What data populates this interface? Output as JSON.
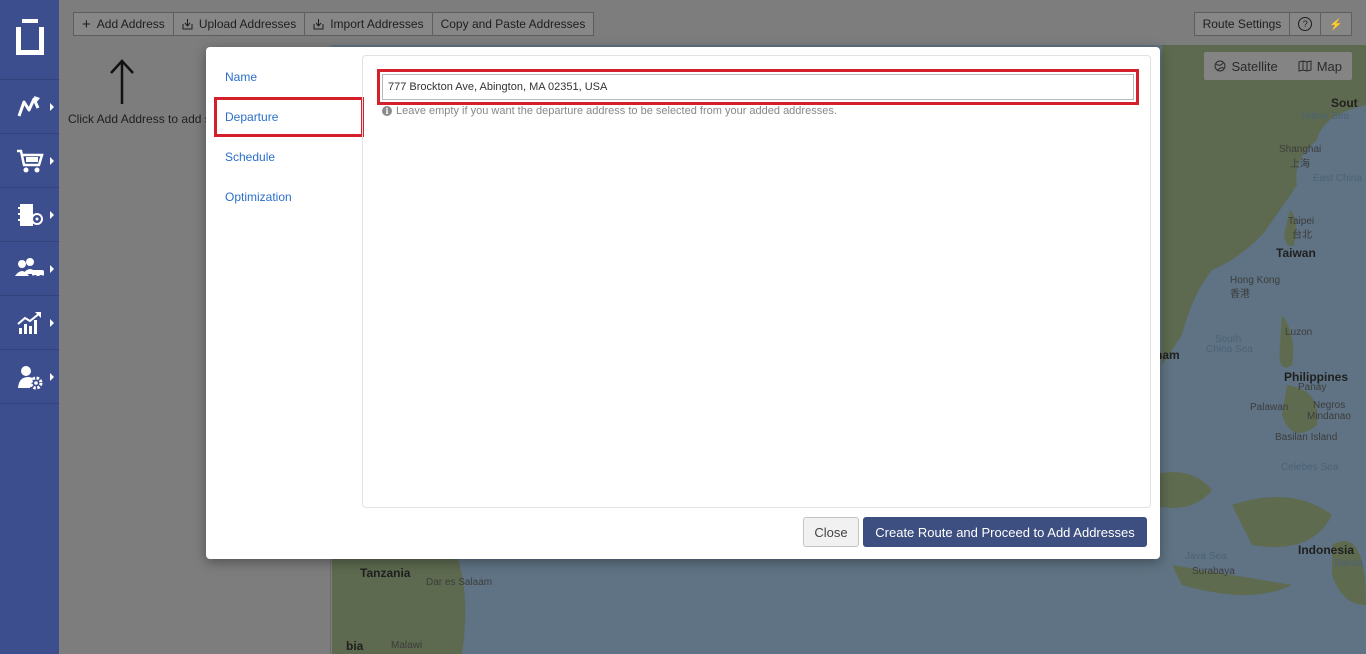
{
  "sidebar": {
    "items": [
      {
        "icon": "route-planner-icon"
      },
      {
        "icon": "shopping-cart-icon"
      },
      {
        "icon": "address-book-icon"
      },
      {
        "icon": "team-vehicles-icon"
      },
      {
        "icon": "analytics-chart-icon"
      },
      {
        "icon": "user-settings-icon"
      }
    ]
  },
  "toolbar": {
    "add_address": "Add Address",
    "upload_addresses": "Upload Addresses",
    "import_addresses": "Import Addresses",
    "copy_paste_addresses": "Copy and Paste Addresses",
    "route_settings": "Route Settings",
    "help": "?",
    "quick": "⚡"
  },
  "left_panel": {
    "hint": "Click Add Address to add st"
  },
  "map": {
    "type_satellite": "Satellite",
    "type_map": "Map",
    "labels": {
      "south": "Sout",
      "yellow_sea": "Yellow Sea",
      "shanghai": "Shanghai",
      "shanghai_cn": "上海",
      "east_china": "East China",
      "taipei": "Taipei",
      "taipei_cn": "台北",
      "taiwan": "Taiwan",
      "hong_kong": "Hong Kong",
      "hong_kong_cn": "香港",
      "south_china_sea_1": "South",
      "south_china_sea_2": "China Sea",
      "vietnam": "tnam",
      "luzon": "Luzon",
      "philippines": "Philippines",
      "panay": "Panay",
      "palawan": "Palawan",
      "negros": "Negros",
      "mindanao": "Mindanao",
      "basilan": "Basilan Island",
      "celebes_sea": "Celebes Sea",
      "java_sea": "Java Sea",
      "surabaya": "Surabaya",
      "indonesia": "Indonesia",
      "banda": "Banda",
      "tanzania": "Tanzania",
      "dar_es_salaam": "Dar es Salaam",
      "bia": "bia",
      "malawi": "Malawi"
    }
  },
  "modal": {
    "nav": {
      "name": "Name",
      "departure": "Departure",
      "schedule": "Schedule",
      "optimization": "Optimization"
    },
    "departure": {
      "value": "777 Brockton Ave, Abington, MA 02351, USA",
      "help": "Leave empty if you want the departure address to be selected from your added addresses."
    },
    "close_label": "Close",
    "create_label": "Create Route and Proceed to Add Addresses"
  },
  "colors": {
    "sidebar": "#3d4e8e",
    "primary_button": "#3d4e80",
    "highlight": "#d3202b",
    "link": "#2a6fc9"
  }
}
